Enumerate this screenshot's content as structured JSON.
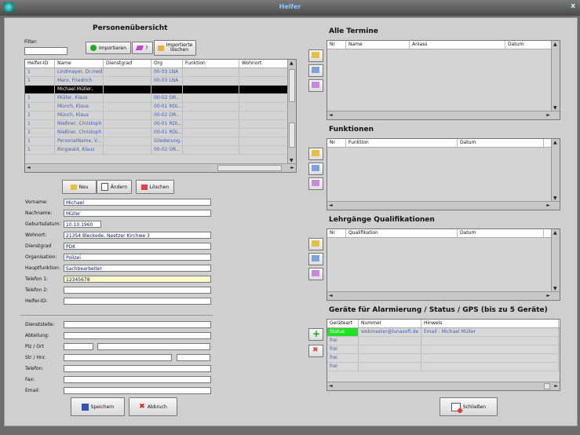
{
  "window": {
    "title": "Helfer",
    "close": "x"
  },
  "left": {
    "header": "Personenübersicht",
    "filter_label": "Filter:",
    "filter_value": "",
    "btn_import": "Importieren",
    "btn_question": "?",
    "btn_delete_imported_l1": "Importierte",
    "btn_delete_imported_l2": "löschen",
    "columns": [
      "Helfer-ID",
      "Name",
      "Dienstgrad",
      "Org",
      "Funktion",
      "Wohnort"
    ],
    "rows": [
      [
        "1",
        "Lindmayer, Dr.med....",
        "",
        "00-03 LNA",
        "",
        ""
      ],
      [
        "1",
        "Marx, Friedrich",
        "",
        "00-03 LNA",
        "",
        ""
      ],
      [
        "",
        "Michael Müller,",
        "",
        "",
        "",
        ""
      ],
      [
        "1",
        "Müller, Klaus",
        "",
        "00-02 OR...",
        "",
        ""
      ],
      [
        "1",
        "Münch, Klaus",
        "",
        "00-01 RDL...",
        "",
        ""
      ],
      [
        "1",
        "Münch, Klaus",
        "",
        "00-02 OR...",
        "",
        ""
      ],
      [
        "1",
        "Nießner, Christoph",
        "",
        "00-01 RDL...",
        "",
        ""
      ],
      [
        "1",
        "Nießner, Christoph",
        "",
        "00-01 RDL...",
        "",
        ""
      ],
      [
        "1",
        "PersonalName, V...",
        "",
        "Gliederung...",
        "",
        ""
      ],
      [
        "1",
        "Ringwald, Klaus",
        "",
        "00-02 OR...",
        "",
        ""
      ]
    ],
    "selected_row": 2,
    "btn_new": "Neu",
    "btn_change": "Ändern",
    "btn_delete": "Löschen",
    "form": {
      "vorname_label": "Vorname:",
      "vorname": "Michael",
      "nachname_label": "Nachname:",
      "nachname": "Müller",
      "geburt_label": "Geburtsdatum:",
      "geburt": "10.10.1960",
      "wohnort_label": "Wohnort:",
      "wohnort": "21354 Bleckede, Neetzer Kirchwe 3",
      "dienstgrad_label": "Dienstgrad",
      "dienstgrad": "PDK",
      "org_label": "Organisation:",
      "org": "Polizei",
      "haupt_label": "Hauptfunktion:",
      "haupt": "Sachbearbeiter",
      "tel1_label": "Telefon 1:",
      "tel1": "12345678",
      "tel2_label": "Telefon 2:",
      "tel2": "",
      "helferid_label": "Helfer-ID:",
      "helferid": "",
      "dienststelle_label": "Dienststelle:",
      "dienststelle": "",
      "abteilung_label": "Abteilung:",
      "abteilung": "",
      "plz_label": "Plz / Ort",
      "plz": "",
      "ort": "",
      "str_label": "Str / Hnr.",
      "str": "",
      "hnr": "",
      "telefon_label": "Telefon:",
      "telefon": "",
      "fax_label": "Fax:",
      "fax": "",
      "email_label": "Email:",
      "email": ""
    },
    "btn_save": "Speichern",
    "btn_cancel": "Abbruch"
  },
  "right": {
    "termine_header": "Alle Termine",
    "termine_cols": [
      "Nr",
      "Name",
      "Anlass",
      "Datum"
    ],
    "funktionen_header": "Funktionen",
    "funktionen_cols": [
      "Nr",
      "Funktion",
      "Datum"
    ],
    "lehrgaenge_header": "Lehrgänge Qualifikationen",
    "lehrgaenge_cols": [
      "Nr",
      "Qualifikation",
      "Datum"
    ],
    "geraete_header": "Geräte für Alarmierung / Status / GPS  (bis zu 5 Geräte)",
    "geraete_cols": [
      "Geräteart",
      "Nummer",
      "Hinweis"
    ],
    "geraete_rows": [
      [
        "Status",
        "webmaster@lunasoft.de",
        "Email - Michael Müller"
      ],
      [
        "frei",
        "",
        ""
      ],
      [
        "frei",
        "",
        ""
      ],
      [
        "frei",
        "",
        ""
      ],
      [
        "frei",
        "",
        ""
      ]
    ],
    "btn_close": "Schließen"
  },
  "colors": {
    "status_green": "#22e022",
    "selected_row": "#000000",
    "tel_highlight": "#ffffcc"
  }
}
